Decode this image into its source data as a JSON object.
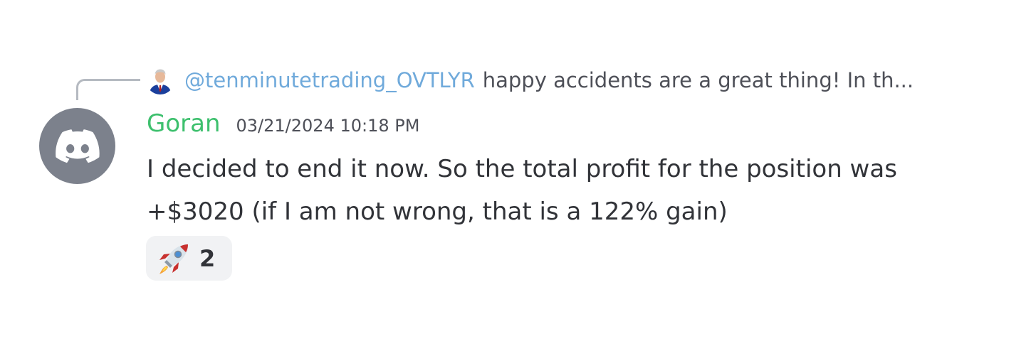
{
  "reply": {
    "author": "@tenminutetrading_OVTLYR",
    "preview": "happy accidents are a great thing! In th..."
  },
  "message": {
    "username": "Goran",
    "timestamp": "03/21/2024 10:18 PM",
    "lines": [
      "I decided to end it now. So the total profit for the position was",
      "+$3020 (if I am not wrong, that is a 122% gain)"
    ]
  },
  "reaction": {
    "emoji": "rocket-icon",
    "count": "2"
  },
  "colors": {
    "username": "#3ec06e",
    "mention": "#70aadb",
    "avatar_bg": "#7c818c",
    "reaction_bg": "#f1f2f4"
  }
}
